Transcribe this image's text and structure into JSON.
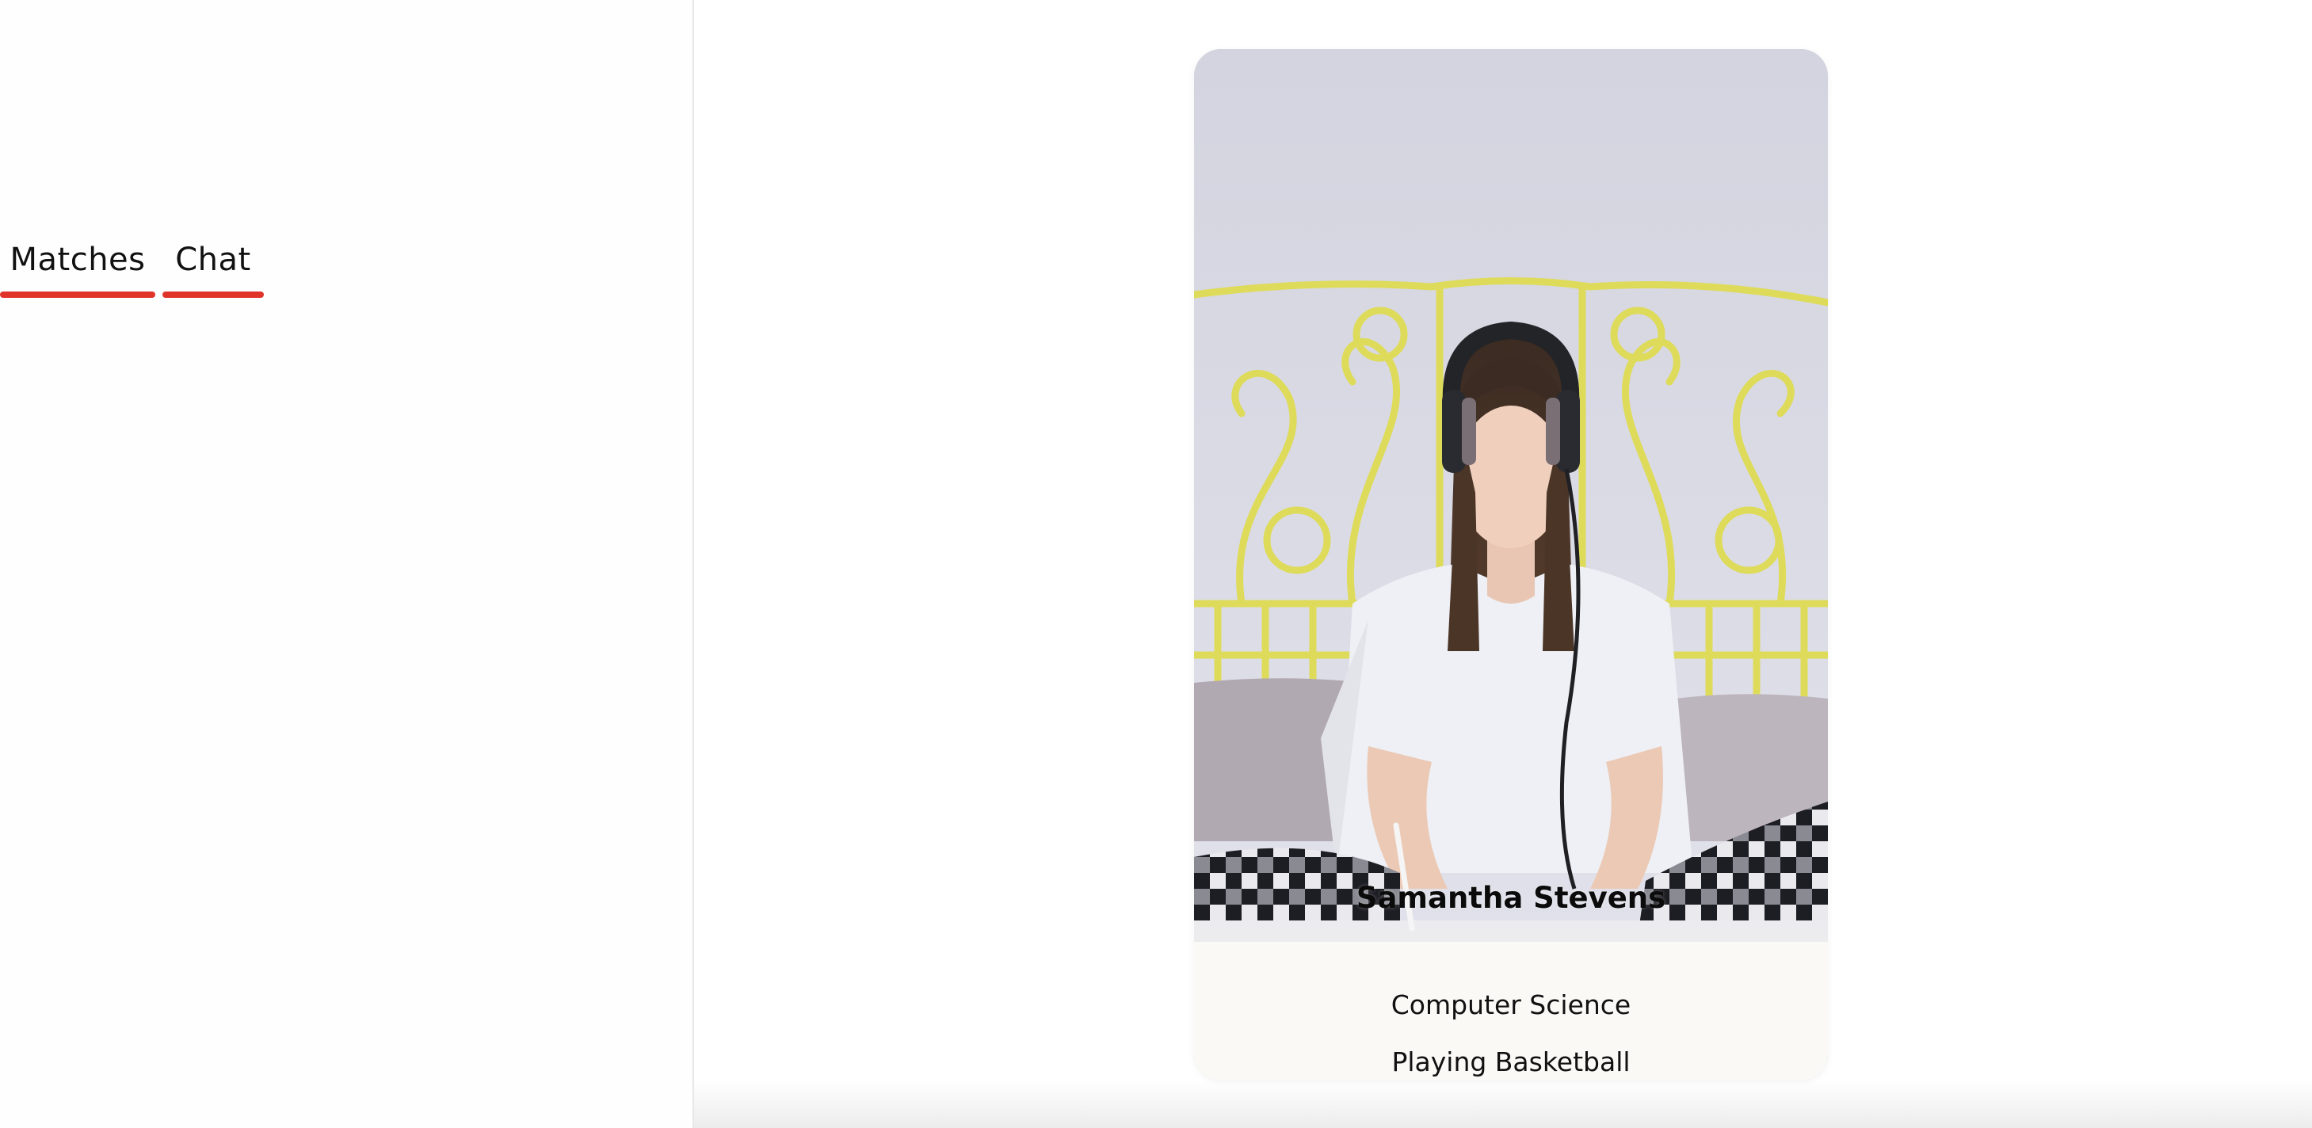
{
  "sidebar": {
    "tabs": [
      {
        "label": "Matches",
        "active": true
      },
      {
        "label": "Chat",
        "active": false
      }
    ],
    "accent_color": "#e0342b"
  },
  "profile_card": {
    "name": "Samantha Stevens",
    "major": "Computer Science",
    "hobby": "Playing Basketball",
    "photo_subject": "person-photo"
  }
}
